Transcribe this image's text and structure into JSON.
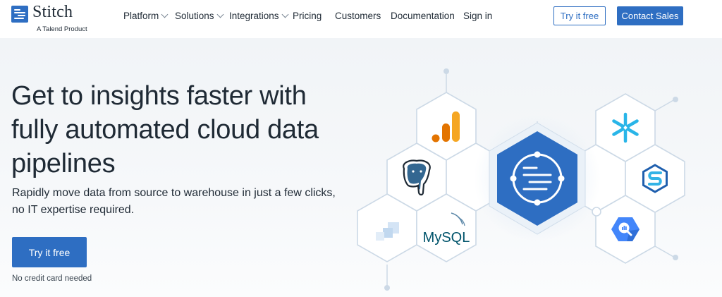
{
  "brand": {
    "name": "Stitch",
    "tagline": "A Talend Product",
    "color": "#2e6ec2"
  },
  "nav": {
    "items": [
      {
        "label": "Platform",
        "has_dropdown": true
      },
      {
        "label": "Solutions",
        "has_dropdown": true
      },
      {
        "label": "Integrations",
        "has_dropdown": true
      },
      {
        "label": "Pricing",
        "has_dropdown": false
      },
      {
        "label": "Customers",
        "has_dropdown": false
      },
      {
        "label": "Documentation",
        "has_dropdown": false
      },
      {
        "label": "Sign in",
        "has_dropdown": false
      }
    ],
    "try_label": "Try it free",
    "contact_label": "Contact Sales"
  },
  "hero": {
    "headline": "Get to insights faster with fully automated cloud data pipelines",
    "subhead": "Rapidly move data from source to warehouse in just a few clicks, no IT expertise required.",
    "cta_label": "Try it free",
    "note": "No credit card needed"
  },
  "graphic": {
    "logos": {
      "mysql": "MySQL"
    },
    "icons": [
      "google-analytics-icon",
      "postgresql-icon",
      "generic-source-icon",
      "mysql-icon",
      "stitch-hub-icon",
      "snowflake-icon",
      "azure-synapse-icon",
      "bigquery-icon"
    ],
    "colors": {
      "hex_border": "#ccd9e6",
      "hub_fill": "#2e6ec2",
      "analytics_orange": "#f5a623",
      "analytics_dark": "#e37400",
      "snowflake": "#29b5e8",
      "postgres": "#336791",
      "bigquery": "#4386fa"
    }
  }
}
